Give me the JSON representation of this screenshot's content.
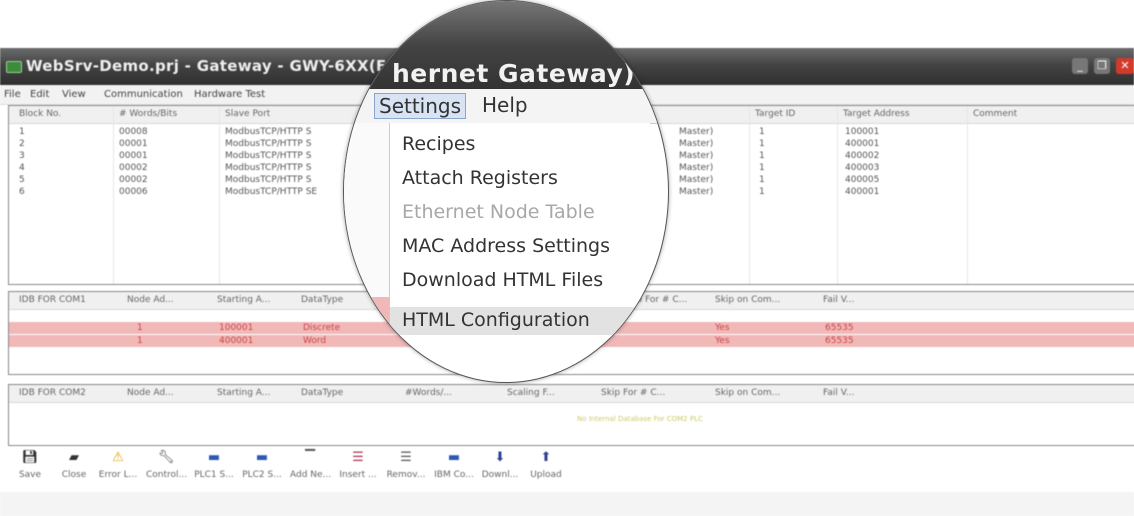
{
  "window": {
    "title": "WebSrv-Demo.prj - Gateway - GWY-6XX(Et",
    "lens_title": "hernet Gateway)"
  },
  "menu": {
    "items": [
      "File",
      "Edit",
      "View",
      "Communication",
      "Hardware Test",
      "Settings",
      "Help"
    ]
  },
  "settings_menu": {
    "items": [
      {
        "label": "Recipes",
        "enabled": true
      },
      {
        "label": "Attach Registers",
        "enabled": true
      },
      {
        "label": "Ethernet Node Table",
        "enabled": false
      },
      {
        "label": "MAC Address Settings",
        "enabled": true
      },
      {
        "label": "Download HTML Files",
        "enabled": true
      },
      {
        "label": "HTML Configuration",
        "enabled": true,
        "highlighted": true
      }
    ]
  },
  "blocks_table": {
    "columns": [
      "Block No.",
      "# Words/Bits",
      "Slave Port",
      "Target ID",
      "Target Address",
      "Comment"
    ],
    "rows": [
      {
        "block": "1",
        "words": "00008",
        "port": "ModbusTCP/HTTP S",
        "tail": "Master)",
        "target_id": "1",
        "target_addr": "100001"
      },
      {
        "block": "2",
        "words": "00001",
        "port": "ModbusTCP/HTTP S",
        "tail": "Master)",
        "target_id": "1",
        "target_addr": "400001"
      },
      {
        "block": "3",
        "words": "00001",
        "port": "ModbusTCP/HTTP S",
        "tail": "Master)",
        "target_id": "1",
        "target_addr": "400002"
      },
      {
        "block": "4",
        "words": "00002",
        "port": "ModbusTCP/HTTP S",
        "tail": "Master)",
        "target_id": "1",
        "target_addr": "400003"
      },
      {
        "block": "5",
        "words": "00002",
        "port": "ModbusTCP/HTTP S",
        "tail": "Master)",
        "target_id": "1",
        "target_addr": "400005"
      },
      {
        "block": "6",
        "words": "00006",
        "port": "ModbusTCP/HTTP SE",
        "tail": "Master)",
        "target_id": "1",
        "target_addr": "400001"
      }
    ]
  },
  "com1_table": {
    "columns": [
      "IDB FOR COM1",
      "Node Ad...",
      "Starting A...",
      "DataType",
      "Skip For # C...",
      "Skip on Com...",
      "Fail V..."
    ],
    "rows": [
      {
        "node": "1",
        "start": "100001",
        "type": "Discrete",
        "skip": "Yes",
        "fail": "65535"
      },
      {
        "node": "1",
        "start": "400001",
        "type": "Word",
        "skip": "Yes",
        "fail": "65535"
      }
    ]
  },
  "com2_table": {
    "columns": [
      "IDB FOR COM2",
      "Node Ad...",
      "Starting A...",
      "DataType",
      "#Words/...",
      "Scaling F...",
      "Skip For # C...",
      "Skip on Com...",
      "Fail V..."
    ],
    "empty_text": "No Internal Database For COM2 PLC"
  },
  "toolbar": {
    "buttons": [
      {
        "label": "Save",
        "icon": "floppy-icon"
      },
      {
        "label": "Close",
        "icon": "close-doc-icon"
      },
      {
        "label": "Error L...",
        "icon": "warning-icon"
      },
      {
        "label": "Control...",
        "icon": "wrench-icon"
      },
      {
        "label": "PLC1 S...",
        "icon": "plc-icon"
      },
      {
        "label": "PLC2 S...",
        "icon": "plc-icon"
      },
      {
        "label": "Add Ne...",
        "icon": "add-line-icon"
      },
      {
        "label": "Insert ...",
        "icon": "insert-rows-icon"
      },
      {
        "label": "Remov...",
        "icon": "remove-rows-icon"
      },
      {
        "label": "IBM Co...",
        "icon": "plc-icon"
      },
      {
        "label": "Downl...",
        "icon": "download-icon"
      },
      {
        "label": "Upload",
        "icon": "upload-icon"
      }
    ]
  },
  "colors": {
    "pink_row": "#f1b8b8",
    "close_button": "#d23a2a",
    "titlebar": "#444444"
  }
}
